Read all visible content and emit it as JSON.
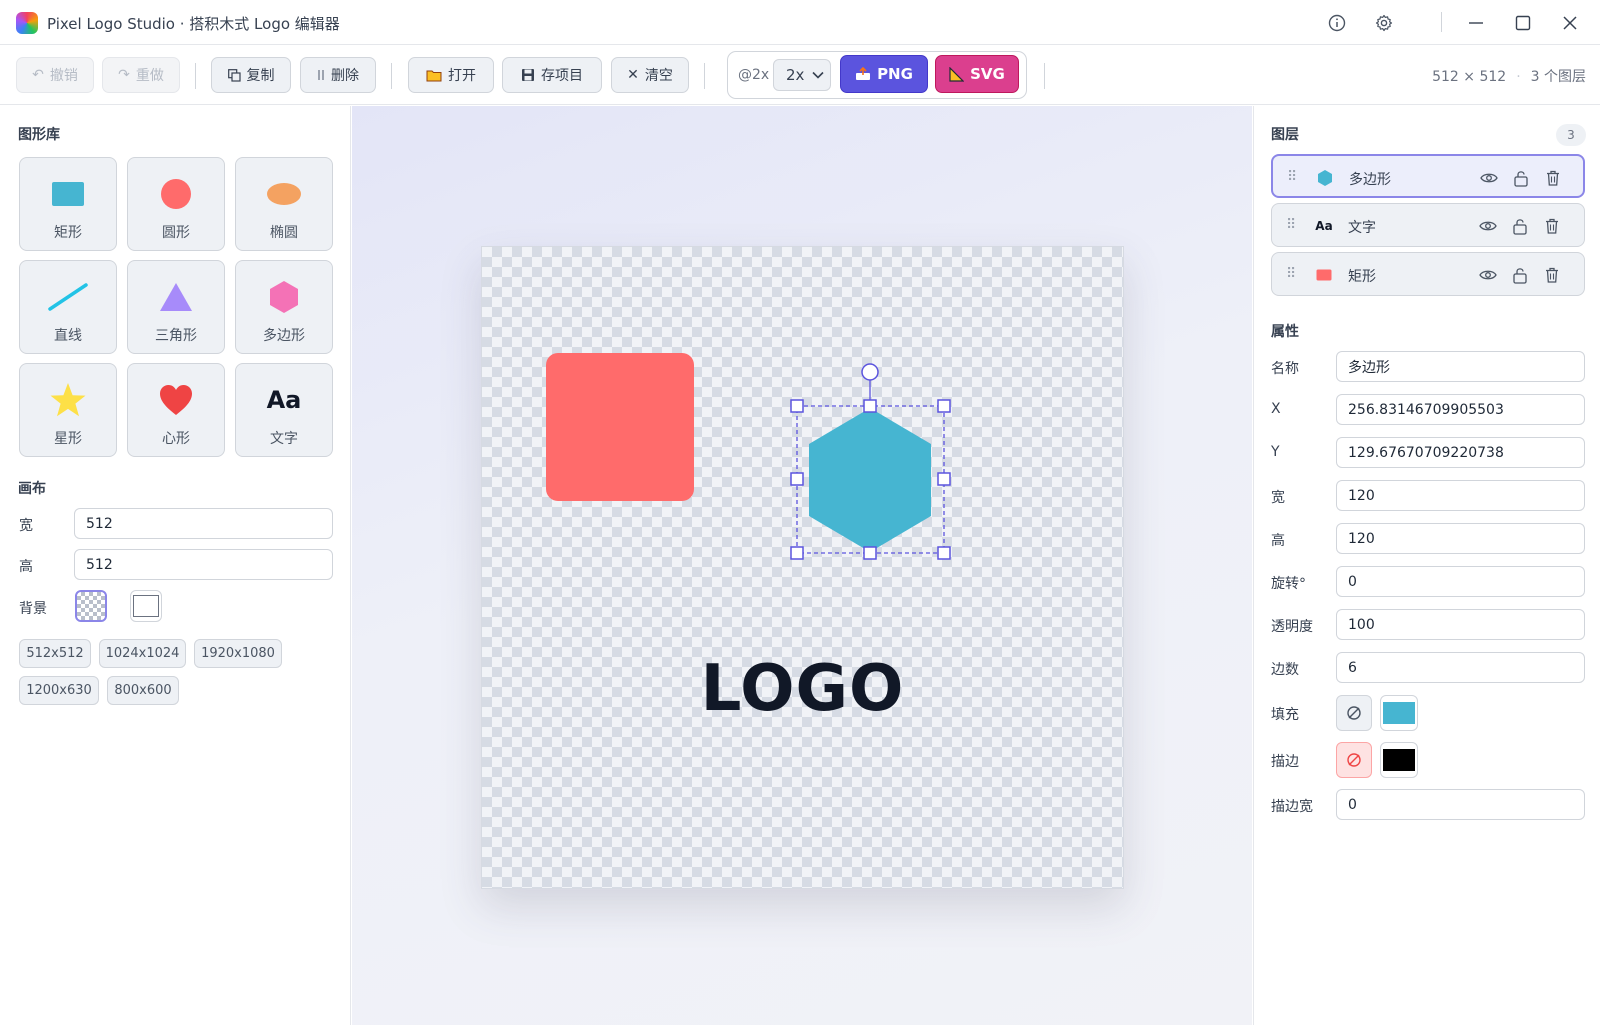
{
  "window": {
    "title": "Pixel Logo Studio · 搭积木式 Logo 编辑器",
    "icons": [
      "info-icon",
      "settings-icon",
      "minimize-icon",
      "maximize-icon",
      "close-icon"
    ]
  },
  "toolbar": {
    "undo": "撤销",
    "redo": "重做",
    "copy": "复制",
    "delete": "删除",
    "open": "打开",
    "save": "存项目",
    "clear": "清空",
    "export_label": "@2x",
    "scale_value": "2x",
    "png": "PNG",
    "svg": "SVG",
    "canvas_size": "512 × 512",
    "separator": "·",
    "layer_count_text": "3 个图层"
  },
  "library": {
    "title": "图形库",
    "shapes": [
      {
        "label": "矩形",
        "icon": "rectangle-icon",
        "color": "#46b5d1"
      },
      {
        "label": "圆形",
        "icon": "circle-icon",
        "color": "#ff6b6b"
      },
      {
        "label": "椭圆",
        "icon": "ellipse-icon",
        "color": "#f4a261"
      },
      {
        "label": "直线",
        "icon": "line-icon",
        "color": "#22c3e6"
      },
      {
        "label": "三角形",
        "icon": "triangle-icon",
        "color": "#a78bfa"
      },
      {
        "label": "多边形",
        "icon": "hexagon-icon",
        "color": "#f472b6"
      },
      {
        "label": "星形",
        "icon": "star-icon",
        "color": "#fde047"
      },
      {
        "label": "心形",
        "icon": "heart-icon",
        "color": "#ef4444"
      },
      {
        "label": "文字",
        "icon": "text-icon",
        "glyph": "Aa"
      }
    ]
  },
  "canvas_settings": {
    "title": "画布",
    "width_label": "宽",
    "width": "512",
    "height_label": "高",
    "height": "512",
    "bg_label": "背景",
    "presets": [
      "512x512",
      "1024x1024",
      "1920x1080",
      "1200x630",
      "800x600"
    ]
  },
  "artboard": {
    "text": "LOGO",
    "rect_color": "#ff6b6b",
    "hexagon_color": "#46b5d1"
  },
  "layers": {
    "title": "图层",
    "count": "3",
    "items": [
      {
        "name": "多边形",
        "icon": "hexagon-icon",
        "selected": true
      },
      {
        "name": "文字",
        "icon": "text-icon",
        "glyph": "Aa",
        "selected": false
      },
      {
        "name": "矩形",
        "icon": "rectangle-icon",
        "selected": false
      }
    ]
  },
  "properties": {
    "title": "属性",
    "name_label": "名称",
    "name": "多边形",
    "x_label": "X",
    "x": "256.83146709905503",
    "y_label": "Y",
    "y": "129.67670709220738",
    "w_label": "宽",
    "w": "120",
    "h_label": "高",
    "h": "120",
    "rot_label": "旋转°",
    "rot": "0",
    "opacity_label": "透明度",
    "opacity": "100",
    "sides_label": "边数",
    "sides": "6",
    "fill_label": "填充",
    "fill_color": "#46b5d1",
    "stroke_label": "描边",
    "stroke_color": "#000000",
    "stroke_w_label": "描边宽",
    "stroke_w": "0"
  }
}
